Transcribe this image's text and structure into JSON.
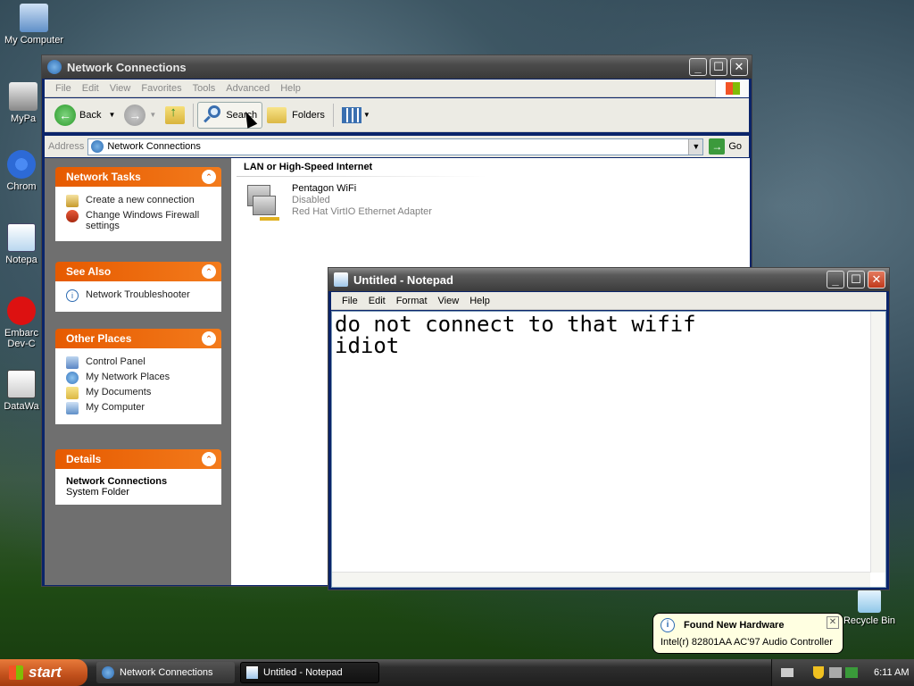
{
  "desktop": {
    "icons": [
      {
        "label": "My Computer"
      },
      {
        "label": "MyPa"
      },
      {
        "label": "Chrom"
      },
      {
        "label": "Notepa"
      },
      {
        "label": "Embarc Dev-C"
      },
      {
        "label": "DataWa"
      },
      {
        "label": "Recycle Bin"
      }
    ]
  },
  "explorer": {
    "title": "Network Connections",
    "menu": [
      "File",
      "Edit",
      "View",
      "Favorites",
      "Tools",
      "Advanced",
      "Help"
    ],
    "toolbar": {
      "back": "Back",
      "search": "Search",
      "folders": "Folders"
    },
    "address": {
      "label": "Address",
      "value": "Network Connections",
      "go": "Go"
    },
    "tasks": {
      "network_tasks": {
        "title": "Network Tasks",
        "items": [
          "Create a new connection",
          "Change Windows Firewall settings"
        ]
      },
      "see_also": {
        "title": "See Also",
        "items": [
          "Network Troubleshooter"
        ]
      },
      "other_places": {
        "title": "Other Places",
        "items": [
          "Control Panel",
          "My Network Places",
          "My Documents",
          "My Computer"
        ]
      },
      "details": {
        "title": "Details",
        "name": "Network Connections",
        "type": "System Folder"
      }
    },
    "group_header": "LAN or High-Speed Internet",
    "connection": {
      "name": "Pentagon WiFi",
      "status": "Disabled",
      "adapter": "Red Hat VirtIO Ethernet Adapter"
    }
  },
  "notepad": {
    "title": "Untitled - Notepad",
    "menu": [
      "File",
      "Edit",
      "Format",
      "View",
      "Help"
    ],
    "text_line1": "do not connect to that wifif",
    "text_line2": "idiot"
  },
  "taskbar": {
    "start": "start",
    "tasks": [
      {
        "label": "Network Connections"
      },
      {
        "label": "Untitled - Notepad"
      }
    ],
    "clock": "6:11 AM"
  },
  "balloon": {
    "title": "Found New Hardware",
    "message": "Intel(r) 82801AA AC'97 Audio Controller"
  },
  "colors": {
    "task_header": "#e65a00",
    "start_button": "#c1501c",
    "balloon": "#ffffe1"
  }
}
